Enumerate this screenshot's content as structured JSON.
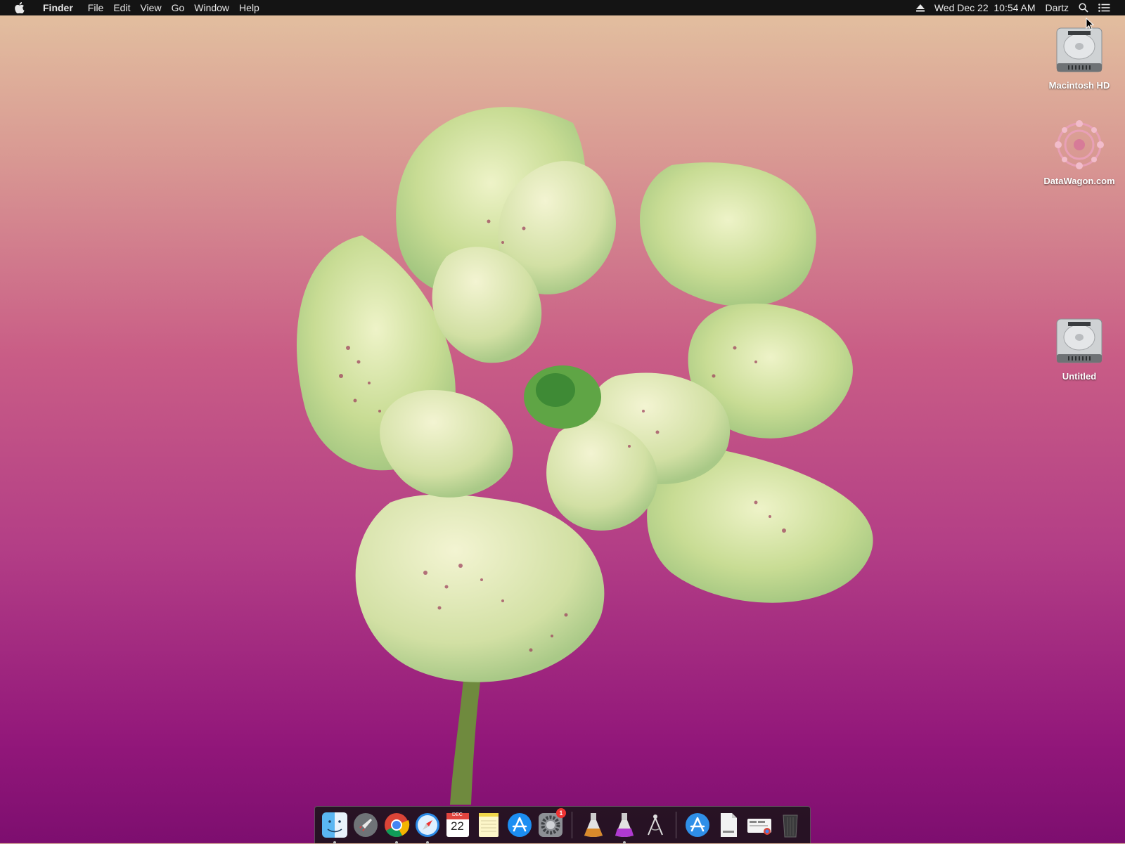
{
  "menubar": {
    "app_name": "Finder",
    "menus": [
      "File",
      "Edit",
      "View",
      "Go",
      "Window",
      "Help"
    ],
    "clock": "Wed Dec 22  10:54 AM",
    "user": "Dartz",
    "icons": [
      "apple-icon",
      "eject-icon",
      "spotlight-search-icon",
      "notification-center-icon"
    ]
  },
  "desktop": {
    "icons": [
      {
        "label": "Macintosh HD",
        "icon": "hard-drive-icon"
      },
      {
        "label": "DataWagon.com",
        "icon": "pink-mandala-icon"
      },
      {
        "label": "Untitled",
        "icon": "hard-drive-icon"
      }
    ],
    "wallpaper_colors": [
      "#e3c2a0",
      "#c95d86",
      "#7d0e6f"
    ]
  },
  "dock": {
    "items": [
      {
        "name": "Finder",
        "icon": "finder-icon",
        "running": true
      },
      {
        "name": "Launchpad",
        "icon": "launchpad-rocket-icon",
        "running": false
      },
      {
        "name": "Google Chrome",
        "icon": "chrome-icon",
        "running": true
      },
      {
        "name": "Safari",
        "icon": "safari-compass-icon",
        "running": true
      },
      {
        "name": "Calendar",
        "icon": "calendar-icon",
        "running": false,
        "month": "DEC",
        "day": "22"
      },
      {
        "name": "Notes",
        "icon": "notes-icon",
        "running": false
      },
      {
        "name": "App Store",
        "icon": "app-store-icon",
        "running": false
      },
      {
        "name": "System Preferences",
        "icon": "system-preferences-gear-icon",
        "running": false,
        "badge": "1"
      },
      {
        "name": "Installer 1",
        "icon": "installer-flask-orange-icon",
        "running": false
      },
      {
        "name": "Installer 2",
        "icon": "installer-flask-purple-icon",
        "running": true
      },
      {
        "name": "Utility",
        "icon": "compass-tool-icon",
        "running": false
      },
      {
        "name": "Applications",
        "icon": "applications-folder-icon",
        "running": false
      },
      {
        "name": "Documents",
        "icon": "document-icon",
        "running": false
      },
      {
        "name": "Downloads",
        "icon": "downloads-stack-icon",
        "running": false
      },
      {
        "name": "Trash",
        "icon": "trash-icon",
        "running": false
      }
    ]
  }
}
